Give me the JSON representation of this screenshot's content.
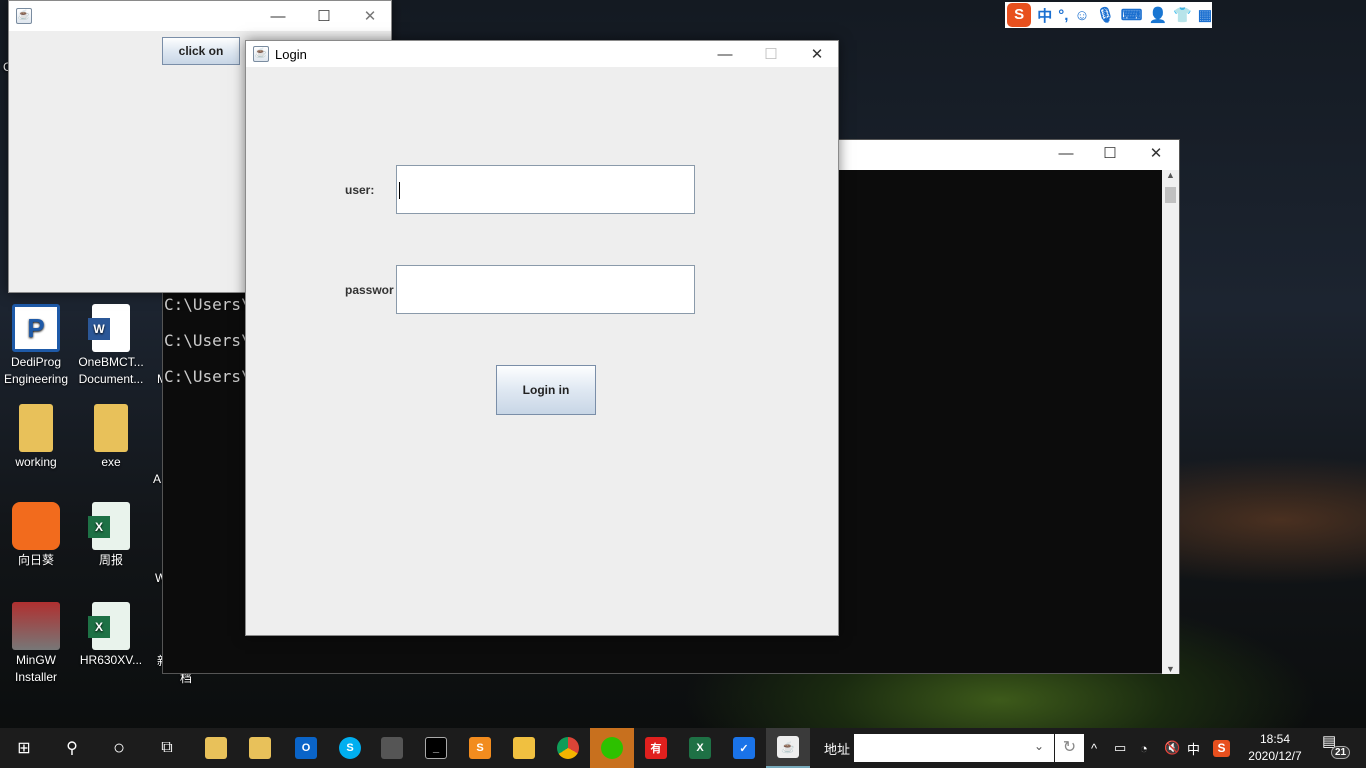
{
  "desktop_icons": [
    {
      "label1": "DediProg",
      "label2": "Engineering",
      "color": "#1e5aa8"
    },
    {
      "label1": "OneBMCT...",
      "label2": "Document...",
      "color": "#2b5797"
    },
    {
      "label1": "working",
      "label2": "",
      "color": "#e8c15a"
    },
    {
      "label1": "exe",
      "label2": "",
      "color": "#e8c15a"
    },
    {
      "label1": "向日葵",
      "label2": "",
      "color": "#f26b1d"
    },
    {
      "label1": "周报",
      "label2": "",
      "color": "#1e7145"
    },
    {
      "label1": "MinGW",
      "label2": "Installer",
      "color": "#b03030"
    },
    {
      "label1": "HR630XV...",
      "label2": "",
      "color": "#1e7145"
    }
  ],
  "partial_labels": [
    "C",
    "M",
    "A",
    "W",
    "新",
    "档"
  ],
  "console": {
    "lines": [
      "C:\\Users\\",
      "C:\\Users\\",
      "C:\\Users\\"
    ]
  },
  "back_window": {
    "button": "click on"
  },
  "login_window": {
    "title": "Login",
    "user_label": "user:",
    "password_label": "passwor",
    "user_value": "",
    "password_value": "",
    "submit": "Login in"
  },
  "ime_bar": {
    "items": [
      "S",
      "中",
      "°,",
      "smile-icon",
      "mic-icon",
      "keyboard-icon",
      "user-icon",
      "shirt-icon",
      "grid-icon"
    ]
  },
  "taskbar": {
    "address_label": "地址",
    "address_value": "",
    "time": "18:54",
    "date": "2020/12/7",
    "notifications": "21",
    "ime": "中",
    "apps": [
      "file-manager",
      "file-manager-2",
      "outlook",
      "skype",
      "terminal-tool",
      "cmd",
      "sublime",
      "explorer",
      "chrome",
      "wechat",
      "youdao",
      "excel",
      "security",
      "java"
    ]
  }
}
